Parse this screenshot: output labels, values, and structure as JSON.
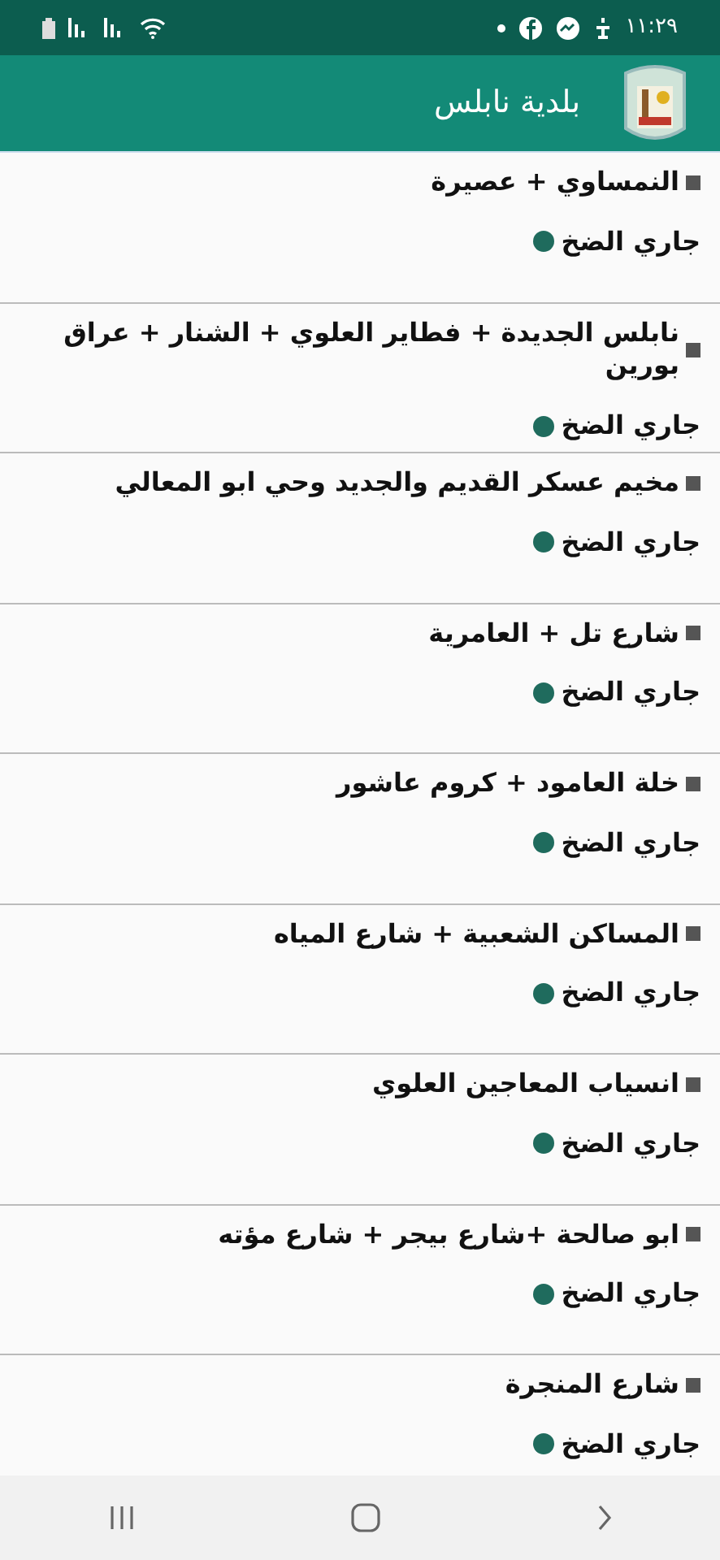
{
  "status_bar": {
    "time": "١١:٢٩"
  },
  "app_bar": {
    "title": "بلدية نابلس"
  },
  "areas": [
    {
      "name": "النمساوي + عصيرة",
      "status": "جاري الضخ"
    },
    {
      "name": "نابلس الجديدة + فطاير العلوي + الشنار + عراق بورين",
      "status": "جاري الضخ"
    },
    {
      "name": "مخيم عسكر القديم والجديد وحي ابو المعالي",
      "status": "جاري الضخ"
    },
    {
      "name": "شارع تل + العامرية",
      "status": "جاري الضخ"
    },
    {
      "name": "خلة العامود + كروم عاشور",
      "status": "جاري الضخ"
    },
    {
      "name": "المساكن الشعبية + شارع المياه",
      "status": "جاري الضخ"
    },
    {
      "name": "انسياب المعاجين العلوي",
      "status": "جاري الضخ"
    },
    {
      "name": "ابو صالحة +شارع بيجر + شارع مؤته",
      "status": "جاري الضخ"
    },
    {
      "name": "شارع المنجرة",
      "status": "جاري الضخ"
    }
  ]
}
